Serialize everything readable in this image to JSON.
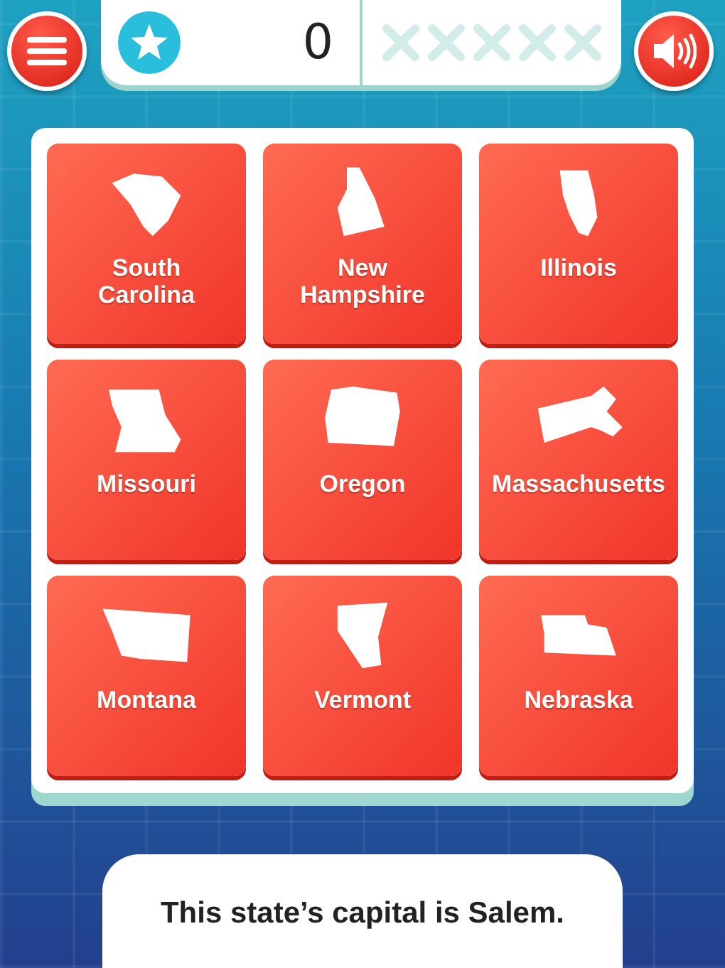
{
  "score": "0",
  "strikes": [
    {
      "used": false
    },
    {
      "used": false
    },
    {
      "used": false
    },
    {
      "used": false
    },
    {
      "used": false
    }
  ],
  "tiles": [
    {
      "label": "South Carolina"
    },
    {
      "label": "New Hampshire"
    },
    {
      "label": "Illinois"
    },
    {
      "label": "Missouri"
    },
    {
      "label": "Oregon"
    },
    {
      "label": "Massachusetts"
    },
    {
      "label": "Montana"
    },
    {
      "label": "Vermont"
    },
    {
      "label": "Nebraska"
    }
  ],
  "clue": "This state’s capital is Salem."
}
